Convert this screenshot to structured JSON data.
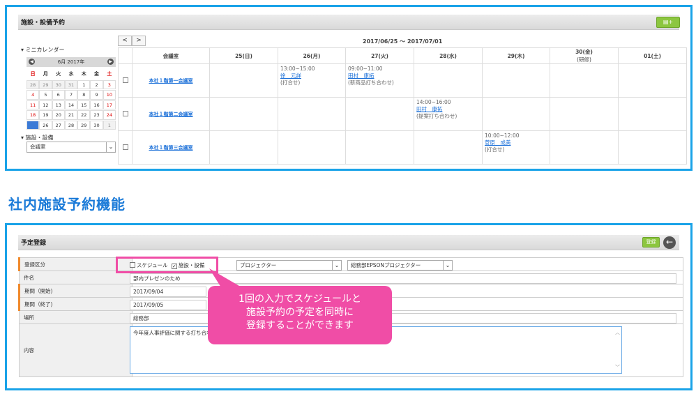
{
  "facility": {
    "title": "施設・設備予約",
    "range": "2017/06/25 ～ 2017/07/01",
    "prev": "<",
    "next": ">",
    "mini_title": "▾ ミニカレンダー",
    "month_label": "6月 2017年",
    "dow": [
      "日",
      "月",
      "火",
      "水",
      "木",
      "金",
      "土"
    ],
    "weeks": [
      [
        "28",
        "29",
        "30",
        "31",
        "1",
        "2",
        "3"
      ],
      [
        "4",
        "5",
        "6",
        "7",
        "8",
        "9",
        "10"
      ],
      [
        "11",
        "12",
        "13",
        "14",
        "15",
        "16",
        "17"
      ],
      [
        "18",
        "19",
        "20",
        "21",
        "22",
        "23",
        "24"
      ],
      [
        "25",
        "26",
        "27",
        "28",
        "29",
        "30",
        "1"
      ]
    ],
    "facility_label": "▾ 施設・設備",
    "facility_select": "会議室",
    "col_room": "会議室",
    "days": [
      "25(日)",
      "26(月)",
      "27(火)",
      "28(水)",
      "29(木)",
      "30(金)",
      "01(土)"
    ],
    "day30_note": "(研修)",
    "rooms": [
      "本社１階第一会議室",
      "本社１階第二会議室",
      "本社１階第三会議室"
    ],
    "events": {
      "r0d1": {
        "time": "13:00~15:00",
        "name": "徐　元詳",
        "note": "(打合せ)"
      },
      "r0d2": {
        "time": "09:00~11:00",
        "name": "田村　康拓",
        "note": "(新商品打ち合わせ)"
      },
      "r1d3": {
        "time": "14:00~16:00",
        "name": "田村　康拓",
        "note": "(提案打ち合わせ)"
      },
      "r2d4": {
        "time": "10:00~12:00",
        "name": "菅原　成美",
        "note": "(打合せ)"
      }
    }
  },
  "heading": "社内施設予約機能",
  "form": {
    "title": "予定登録",
    "register_btn": "登録",
    "rows": [
      "登録区分",
      "件名",
      "期間（開始)",
      "期間（終了)",
      "場所",
      "内容"
    ],
    "opt_schedule": "スケジュール",
    "opt_facility": "施設・設備",
    "facility_type": "プロジェクター",
    "facility_item": "総務部EPSONプロジェクター",
    "subject": "部内プレゼンのため",
    "start": "2017/09/04",
    "end": "2017/09/05",
    "place": "総務部",
    "content": "今年度人事評価に関する打ち合わせで使用します"
  },
  "callout": {
    "line1": "1回の入力でスケジュールと",
    "line2": "施設予約の予定を同時に",
    "line3": "登録することができます"
  },
  "colors": {
    "panel_border": "#1aa3e8",
    "heading": "#1a7ad8",
    "callout": "#f04da6",
    "accent_green": "#8cc63f"
  }
}
